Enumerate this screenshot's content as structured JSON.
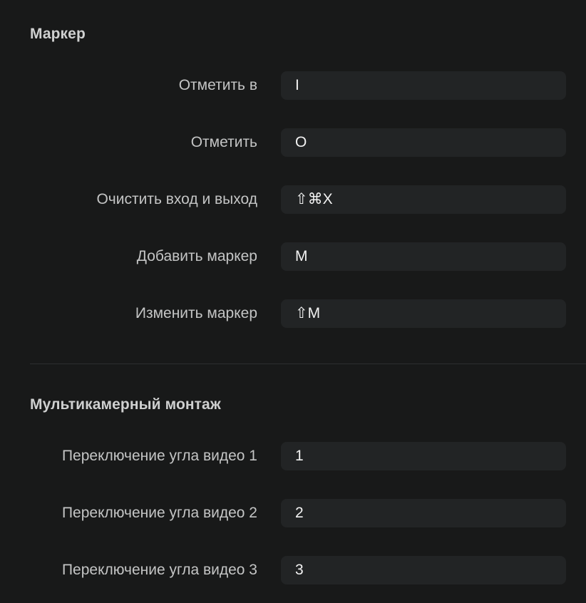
{
  "sections": [
    {
      "title": "Маркер",
      "rows": [
        {
          "label": "Отметить в",
          "shortcut": "I"
        },
        {
          "label": "Отметить",
          "shortcut": "O"
        },
        {
          "label": "Очистить вход и выход",
          "shortcut": "⇧⌘X"
        },
        {
          "label": "Добавить маркер",
          "shortcut": "M"
        },
        {
          "label": "Изменить маркер",
          "shortcut": "⇧M"
        }
      ]
    },
    {
      "title": "Мультикамерный монтаж",
      "rows": [
        {
          "label": "Переключение угла видео 1",
          "shortcut": "1"
        },
        {
          "label": "Переключение угла видео 2",
          "shortcut": "2"
        },
        {
          "label": "Переключение угла видео 3",
          "shortcut": "3"
        }
      ]
    }
  ]
}
